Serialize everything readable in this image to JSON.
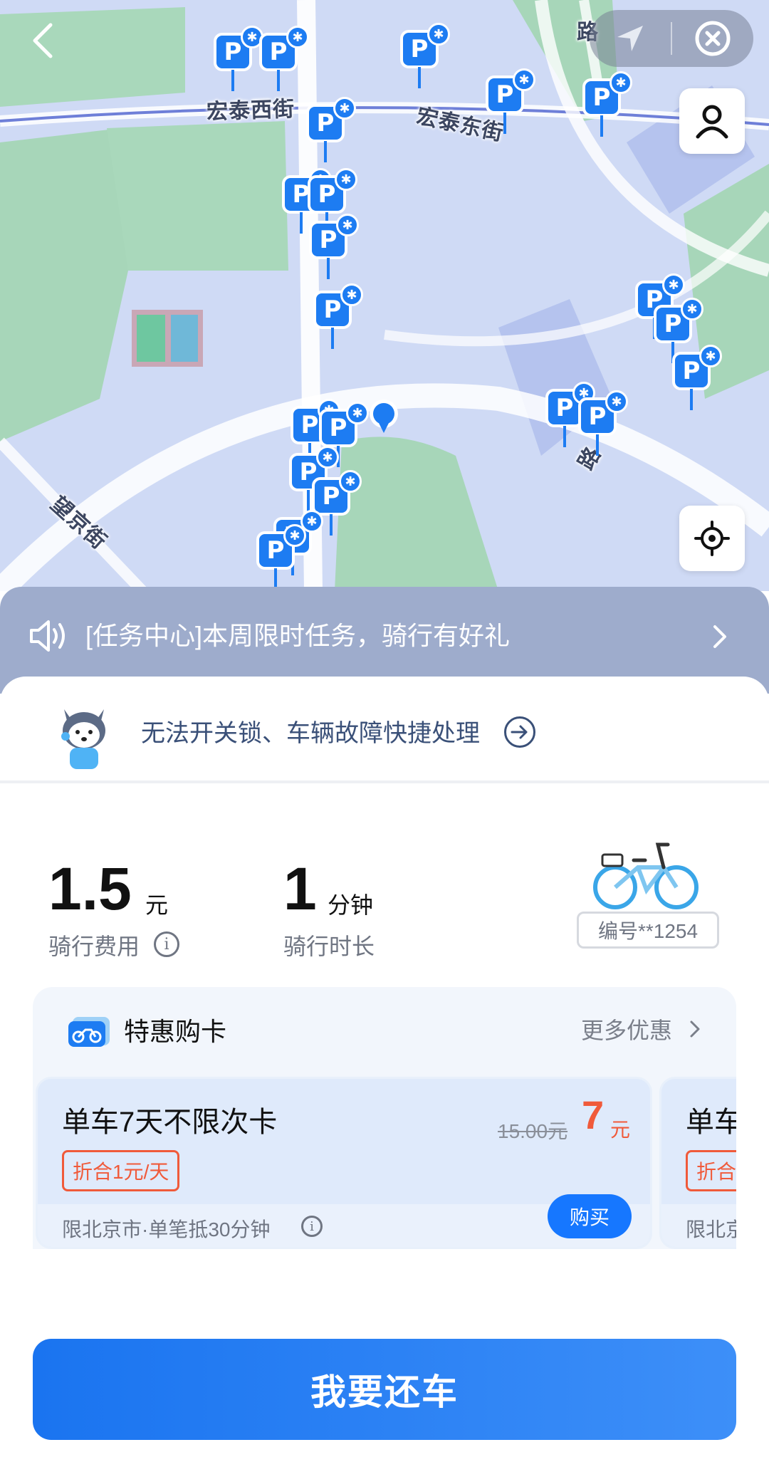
{
  "map": {
    "streets": [
      "宏泰西街",
      "宏泰东街",
      "望京街",
      "路",
      "路"
    ],
    "parking_glyph": "P",
    "bluetooth_glyph": "✱",
    "icons": [
      "back-arrow-icon",
      "navigation-icon",
      "close-circle-icon",
      "user-icon",
      "locate-icon"
    ]
  },
  "task_banner": {
    "text": "[任务中心]本周限时任务，骑行有好礼"
  },
  "help": {
    "text": "无法开关锁、车辆故障快捷处理"
  },
  "ride": {
    "fee_value": "1.5",
    "fee_unit": "元",
    "fee_label": "骑行费用",
    "duration_value": "1",
    "duration_unit": "分钟",
    "duration_label": "骑行时长",
    "bike_number": "编号**1254"
  },
  "offers": {
    "title": "特惠购卡",
    "more": "更多优惠",
    "cards": [
      {
        "name": "单车7天不限次卡",
        "tag": "折合1元/天",
        "original_price": "15.00元",
        "price": "7",
        "price_unit": "元",
        "footnote": "限北京市·单笔抵30分钟",
        "buy_label": "购买"
      },
      {
        "name": "单车",
        "tag": "折合",
        "footnote": "限北京"
      }
    ]
  },
  "return_button": "我要还车",
  "colors": {
    "accent": "#1677ff",
    "price": "#f05a3a",
    "banner": "#9eaccc",
    "map_bg": "#cfdaf5"
  }
}
